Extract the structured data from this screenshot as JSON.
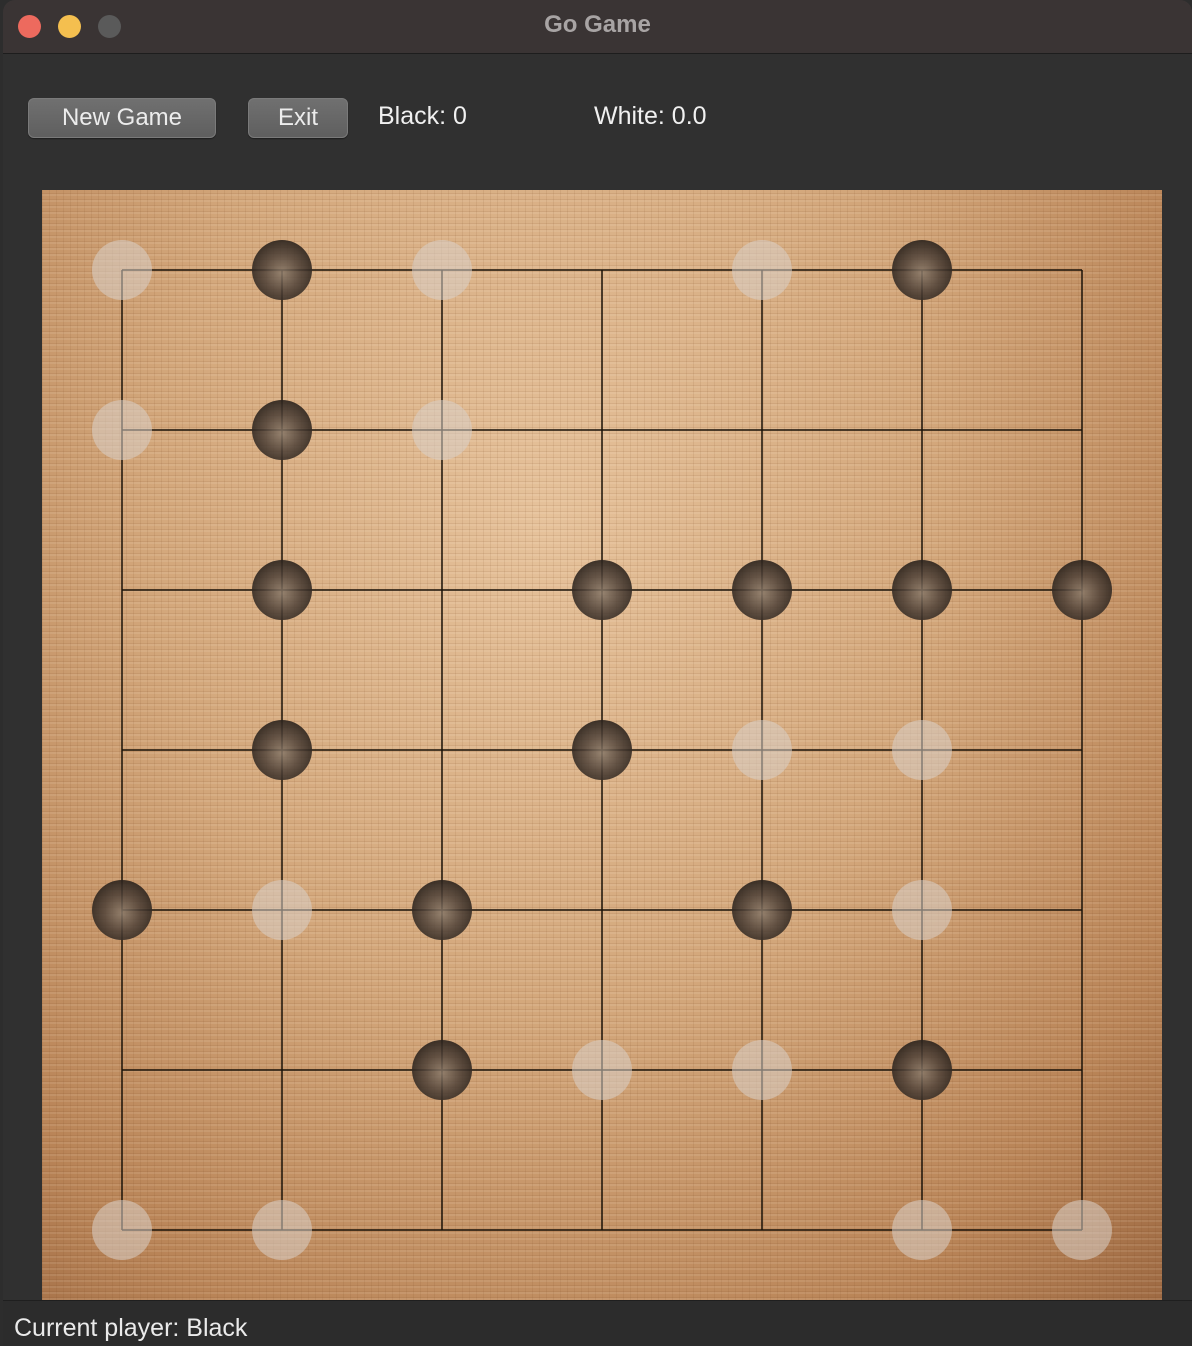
{
  "window": {
    "title": "Go Game"
  },
  "toolbar": {
    "new_game_label": "New Game",
    "exit_label": "Exit",
    "black_score": "Black: 0",
    "white_score": "White: 0.0"
  },
  "status": {
    "current_player": "Current player: Black"
  },
  "colors": {
    "close": "#ed6a5e",
    "minimize": "#f4bf4f",
    "maximize": "#5a5a5a",
    "grid_line": "#1a1208",
    "black_stone": "#3a3028",
    "white_stone": "#d9d0c8"
  },
  "board": {
    "columns": 7,
    "rows": 7,
    "stones": [
      {
        "col": 0,
        "row": 0,
        "color": "white"
      },
      {
        "col": 1,
        "row": 0,
        "color": "black"
      },
      {
        "col": 2,
        "row": 0,
        "color": "white"
      },
      {
        "col": 4,
        "row": 0,
        "color": "white"
      },
      {
        "col": 5,
        "row": 0,
        "color": "black"
      },
      {
        "col": 0,
        "row": 1,
        "color": "white"
      },
      {
        "col": 1,
        "row": 1,
        "color": "black"
      },
      {
        "col": 2,
        "row": 1,
        "color": "white"
      },
      {
        "col": 1,
        "row": 2,
        "color": "black"
      },
      {
        "col": 3,
        "row": 2,
        "color": "black"
      },
      {
        "col": 4,
        "row": 2,
        "color": "black"
      },
      {
        "col": 5,
        "row": 2,
        "color": "black"
      },
      {
        "col": 6,
        "row": 2,
        "color": "black"
      },
      {
        "col": 1,
        "row": 3,
        "color": "black"
      },
      {
        "col": 3,
        "row": 3,
        "color": "black"
      },
      {
        "col": 4,
        "row": 3,
        "color": "white"
      },
      {
        "col": 5,
        "row": 3,
        "color": "white"
      },
      {
        "col": 0,
        "row": 4,
        "color": "black"
      },
      {
        "col": 1,
        "row": 4,
        "color": "white"
      },
      {
        "col": 2,
        "row": 4,
        "color": "black"
      },
      {
        "col": 4,
        "row": 4,
        "color": "black"
      },
      {
        "col": 5,
        "row": 4,
        "color": "white"
      },
      {
        "col": 2,
        "row": 5,
        "color": "black"
      },
      {
        "col": 3,
        "row": 5,
        "color": "white"
      },
      {
        "col": 4,
        "row": 5,
        "color": "white"
      },
      {
        "col": 5,
        "row": 5,
        "color": "black"
      },
      {
        "col": 0,
        "row": 6,
        "color": "white"
      },
      {
        "col": 1,
        "row": 6,
        "color": "white"
      },
      {
        "col": 5,
        "row": 6,
        "color": "white"
      },
      {
        "col": 6,
        "row": 6,
        "color": "white"
      }
    ]
  }
}
